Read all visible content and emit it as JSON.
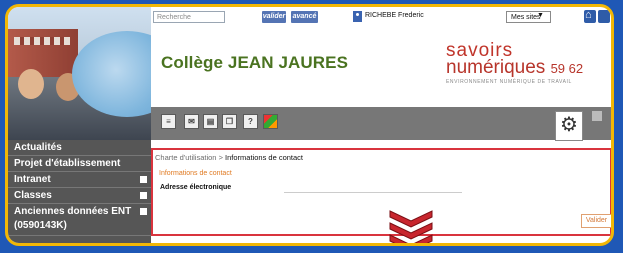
{
  "topbar": {
    "search_placeholder": "Recherche",
    "valider_label": "valider",
    "avance_label": "avancé",
    "user_name": "RICHEBE Frederic",
    "sites_select": "Mes sites",
    "sites_arrow": "▼"
  },
  "header": {
    "site_title": "Collège JEAN JAURES",
    "brand_line1": "savoirs",
    "brand_line2_word": "numériques",
    "brand_line2_num": "59 62",
    "brand_tagline": "ENVIRONNEMENT NUMÉRIQUE DE TRAVAIL"
  },
  "toolbar": {
    "icons": [
      "list-icon",
      "mail-icon",
      "document-icon",
      "copy-icon",
      "help-icon",
      "apps-icon"
    ],
    "help_glyph": "?",
    "settings_glyph": "⚙"
  },
  "sidebar": {
    "items": [
      {
        "label": "Actualités",
        "expandable": false
      },
      {
        "label": "Projet d'établissement",
        "expandable": false
      },
      {
        "label": "Intranet",
        "expandable": true
      },
      {
        "label": "Classes",
        "expandable": true
      },
      {
        "label": "Anciennes données ENT (0590143K)",
        "label_line1": "Anciennes données ENT",
        "label_line2": "(0590143K)",
        "expandable": true
      }
    ]
  },
  "main": {
    "breadcrumb_parent": "Charte d'utilisation",
    "breadcrumb_sep": ">",
    "breadcrumb_current": "Informations de contact",
    "section_title": "Informations de contact",
    "email_label": "Adresse électronique",
    "email_value": "",
    "submit_label": "Valider"
  },
  "colors": {
    "page_bg": "#1f58b6",
    "frame_border": "#f2b705",
    "highlight_border": "#d9343e",
    "title_green": "#4a7320",
    "brand_red": "#c0342a",
    "section_orange": "#e07a22"
  }
}
